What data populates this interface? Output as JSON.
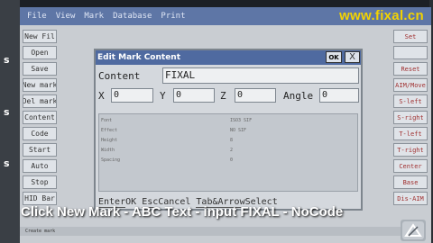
{
  "menubar": [
    "File",
    "View",
    "Mark",
    "Database",
    "Print"
  ],
  "watermark": "www.fixal.cn",
  "left_buttons": [
    "New Fil",
    "Open",
    "Save",
    "New mark",
    "Del mark",
    "Content",
    "Code",
    "Start",
    "Auto",
    "Stop",
    "HID Bar"
  ],
  "right_buttons": [
    "Set",
    "",
    "Reset",
    "AIM/Move",
    "S-left",
    "S-right",
    "T-left",
    "T-right",
    "Center",
    "Base",
    "Dis-AIM"
  ],
  "dialog": {
    "title": "Edit Mark Content",
    "ok_label": "OK",
    "close_label": "X",
    "content_label": "Content",
    "content_value": "FIXAL",
    "x_label": "X",
    "x_value": "0",
    "y_label": "Y",
    "y_value": "0",
    "z_label": "Z",
    "z_value": "0",
    "angle_label": "Angle",
    "angle_value": "0",
    "properties": [
      {
        "name": "Font",
        "value": "ISO3 SIF"
      },
      {
        "name": "Effect",
        "value": "NO SIF"
      },
      {
        "name": "Height",
        "value": "8"
      },
      {
        "name": "Width",
        "value": "2"
      },
      {
        "name": "Spacing",
        "value": "0"
      }
    ],
    "hints": {
      "enter_key": "Enter",
      "enter_action": "OK",
      "esc_key": "Esc",
      "esc_action": "Cancel",
      "tab_key": "Tab&Arrow",
      "tab_action": "Select"
    }
  },
  "status_text": "Create mark",
  "caption": "Click New Mark - ABC Text - input FIXAL - NoCode",
  "colors": {
    "menubar": "#5e76a6",
    "dialog_title": "#4f6aa0",
    "watermark": "#f3d300",
    "screen_bg": "#c9cdd2"
  }
}
